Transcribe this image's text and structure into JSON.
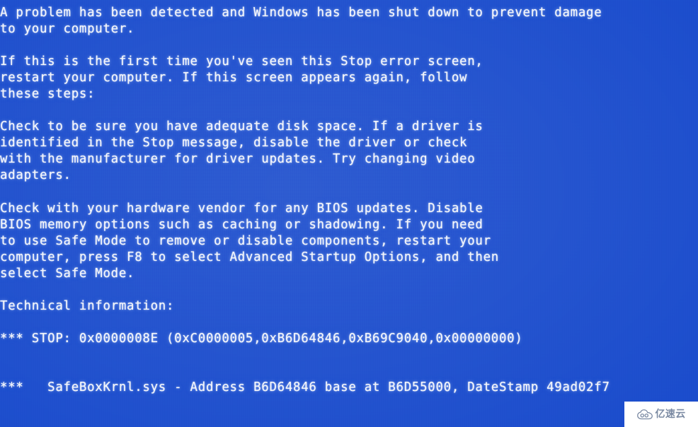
{
  "screen": {
    "kind": "windows-stop-error",
    "background_color": "#1b4dcd",
    "text_color": "#f4f6fb"
  },
  "lines": [
    "A problem has been detected and Windows has been shut down to prevent damage",
    "to your computer.",
    "",
    "If this is the first time you've seen this Stop error screen,",
    "restart your computer. If this screen appears again, follow",
    "these steps:",
    "",
    "Check to be sure you have adequate disk space. If a driver is",
    "identified in the Stop message, disable the driver or check",
    "with the manufacturer for driver updates. Try changing video",
    "adapters.",
    "",
    "Check with your hardware vendor for any BIOS updates. Disable",
    "BIOS memory options such as caching or shadowing. If you need",
    "to use Safe Mode to remove or disable components, restart your",
    "computer, press F8 to select Advanced Startup Options, and then",
    "select Safe Mode.",
    "",
    "Technical information:",
    "",
    "*** STOP: 0x0000008E (0xC0000005,0xB6D64846,0xB69C9040,0x00000000)",
    "",
    "",
    "***   SafeBoxKrnl.sys - Address B6D64846 base at B6D55000, DateStamp 49ad02f7"
  ],
  "error": {
    "headline": "A problem has been detected and Windows has been shut down to prevent damage to your computer.",
    "technical_information_label": "Technical information:",
    "stop_code": "0x0000008E",
    "stop_parameters": [
      "0xC0000005",
      "0xB6D64846",
      "0xB69C9040",
      "0x00000000"
    ],
    "stop_line": "*** STOP: 0x0000008E (0xC0000005,0xB6D64846,0xB69C9040,0x00000000)",
    "driver_name": "SafeBoxKrnl.sys",
    "driver_address": "B6D64846",
    "driver_base": "B6D55000",
    "driver_datestamp": "49ad02f7",
    "driver_line": "***   SafeBoxKrnl.sys - Address B6D64846 base at B6D55000, DateStamp 49ad02f7"
  },
  "watermark": {
    "text": "亿速云",
    "icon": "cloud-icon",
    "color": "#7b8aa3",
    "background": "#ffffff"
  }
}
